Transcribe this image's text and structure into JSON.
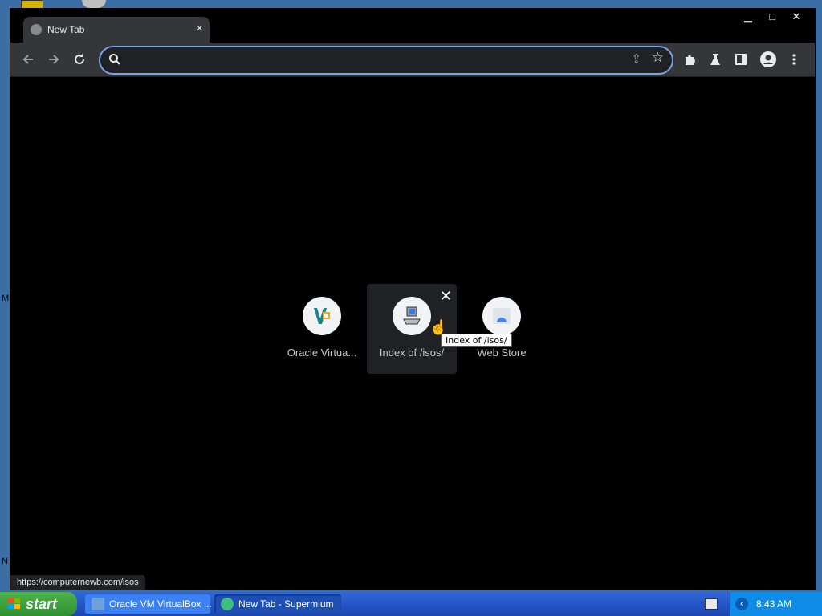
{
  "desktop": {
    "edge_letters": [
      "M",
      "N"
    ]
  },
  "browser": {
    "tab": {
      "title": "New Tab",
      "close": "×"
    },
    "window_controls": {
      "minimize": "▁",
      "maximize": "□",
      "close": "✕"
    },
    "omnibox": {
      "value": "",
      "placeholder": ""
    },
    "shortcuts": [
      {
        "label": "Oracle Virtua...",
        "icon": "virtualbox-icon"
      },
      {
        "label": "Index of /isos/",
        "icon": "computer-icon",
        "hovered": true
      },
      {
        "label": "Web Store",
        "icon": "web-store-icon"
      }
    ],
    "tooltip": "Index of /isos/",
    "status_url": "https://computernewb.com/isos"
  },
  "taskbar": {
    "start_label": "start",
    "tasks": [
      {
        "label": "Oracle VM VirtualBox ..."
      },
      {
        "label": "New Tab - Supermium",
        "active": true
      }
    ],
    "clock": "8:43 AM"
  }
}
